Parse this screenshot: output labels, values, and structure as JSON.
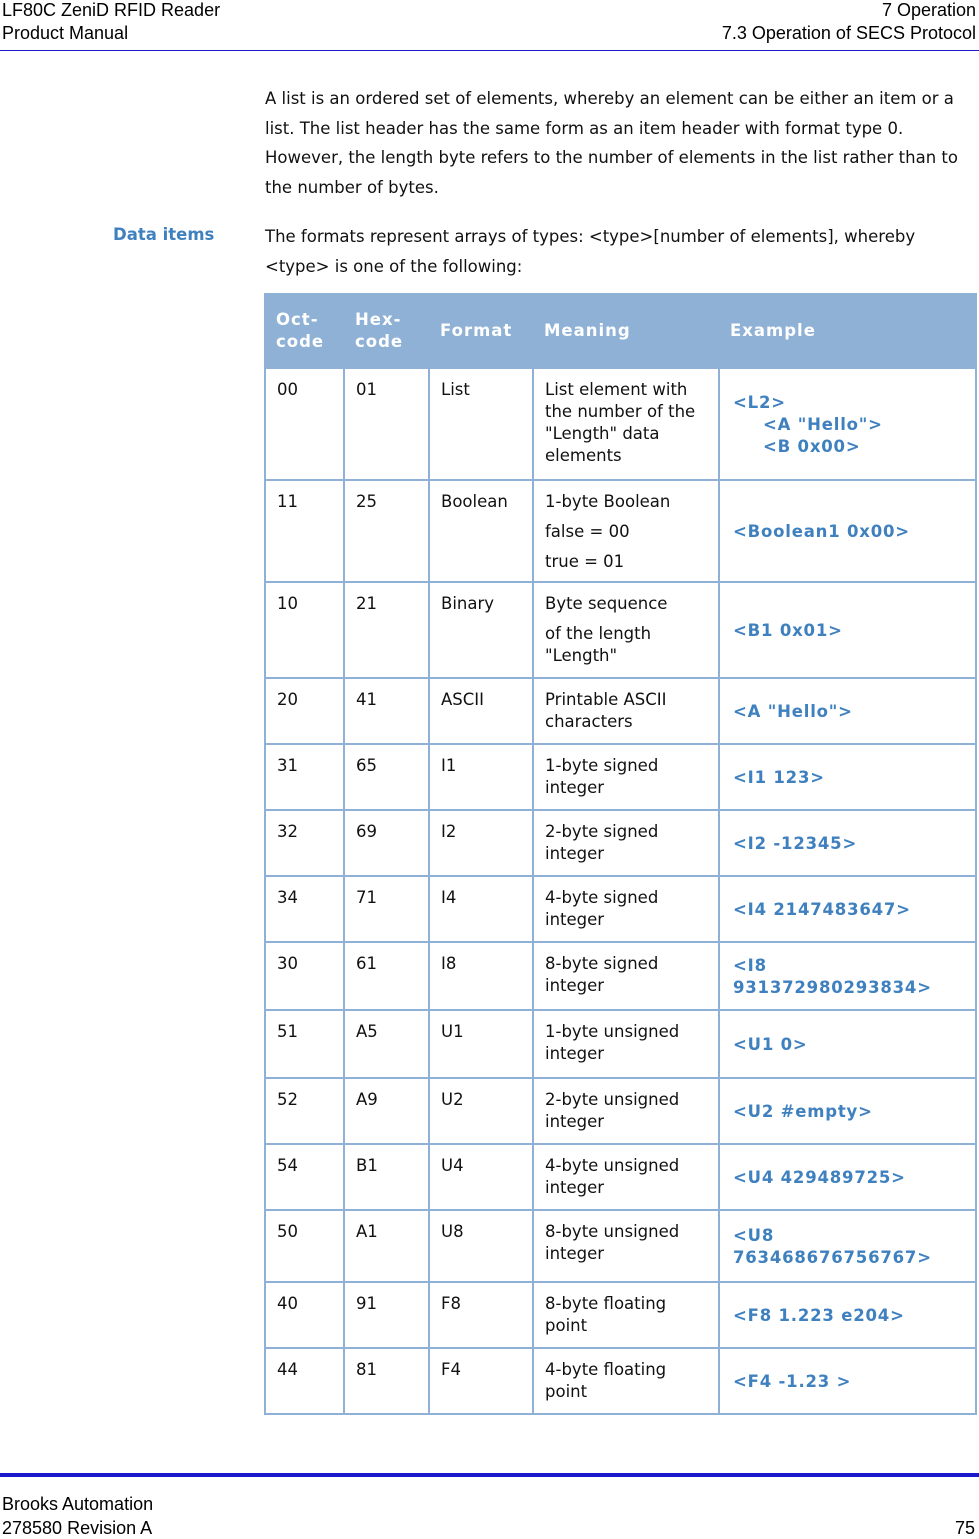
{
  "header": {
    "product": "LF80C ZeniD RFID Reader",
    "doc_type": "Product Manual",
    "chapter": "7 Operation",
    "section": "7.3 Operation of SECS Protocol"
  },
  "intro_paragraph": "A list is an ordered set of elements, whereby an element can be either an item or a list. The list header has the same form as an item header with format type 0. However, the length byte refers to the number of elements in the list rather than to the number of bytes.",
  "data_items": {
    "side_label": "Data items",
    "text": "The formats represent arrays of types: <type>[number of elements], whereby <type> is one of the following:"
  },
  "table": {
    "headers": {
      "oct": "Oct-code",
      "hex": "Hex-code",
      "format": "Format",
      "meaning": "Meaning",
      "example": "Example"
    },
    "rows": [
      {
        "oct": "00",
        "hex": "01",
        "format": "List",
        "meaning": [
          "List element with the number of the \"Length\" data elements"
        ],
        "example": [
          "<L2>",
          "<A \"Hello\">",
          "<B 0x00>"
        ]
      },
      {
        "oct": "11",
        "hex": "25",
        "format": "Boolean",
        "meaning": [
          "1-byte Boolean",
          "false = 00",
          "true = 01"
        ],
        "example": [
          "<Boolean1 0x00>"
        ]
      },
      {
        "oct": "10",
        "hex": "21",
        "format": "Binary",
        "meaning": [
          "Byte sequence",
          "of the length \"Length\""
        ],
        "example": [
          "<B1 0x01>"
        ]
      },
      {
        "oct": "20",
        "hex": "41",
        "format": "ASCII",
        "meaning": [
          "Printable ASCII characters"
        ],
        "example": [
          "<A \"Hello\">"
        ]
      },
      {
        "oct": "31",
        "hex": "65",
        "format": "I1",
        "meaning": [
          "1-byte signed integer"
        ],
        "example": [
          "<I1 123>"
        ]
      },
      {
        "oct": "32",
        "hex": "69",
        "format": "I2",
        "meaning": [
          "2-byte signed integer"
        ],
        "example": [
          "<I2 -12345>"
        ]
      },
      {
        "oct": "34",
        "hex": "71",
        "format": "I4",
        "meaning": [
          "4-byte signed integer"
        ],
        "example": [
          "<I4 2147483647>"
        ]
      },
      {
        "oct": "30",
        "hex": "61",
        "format": "I8",
        "meaning": [
          "8-byte signed integer"
        ],
        "example": [
          "<I8 931372980293834>"
        ]
      },
      {
        "oct": "51",
        "hex": "A5",
        "format": "U1",
        "meaning": [
          "1-byte unsigned integer"
        ],
        "example": [
          "<U1 0>"
        ]
      },
      {
        "oct": "52",
        "hex": "A9",
        "format": "U2",
        "meaning": [
          "2-byte unsigned integer"
        ],
        "example": [
          "<U2 #empty>"
        ]
      },
      {
        "oct": "54",
        "hex": "B1",
        "format": "U4",
        "meaning": [
          "4-byte unsigned integer"
        ],
        "example": [
          "<U4 429489725>"
        ]
      },
      {
        "oct": "50",
        "hex": "A1",
        "format": "U8",
        "meaning": [
          "8-byte unsigned integer"
        ],
        "example": [
          "<U8 763468676756767>"
        ]
      },
      {
        "oct": "40",
        "hex": "91",
        "format": "F8",
        "meaning": [
          "8-byte floating point"
        ],
        "example": [
          "<F8 1.223 e204>"
        ]
      },
      {
        "oct": "44",
        "hex": "81",
        "format": "F4",
        "meaning": [
          "4-byte floating point"
        ],
        "example": [
          "<F4 -1.23 >"
        ]
      }
    ]
  },
  "footer": {
    "company": "Brooks Automation",
    "revision": "278580 Revision A",
    "page_number": "75"
  },
  "colors": {
    "rule": "#1a1acc",
    "table_header_bg": "#8fb1d6",
    "accent_text": "#3f80bf"
  }
}
